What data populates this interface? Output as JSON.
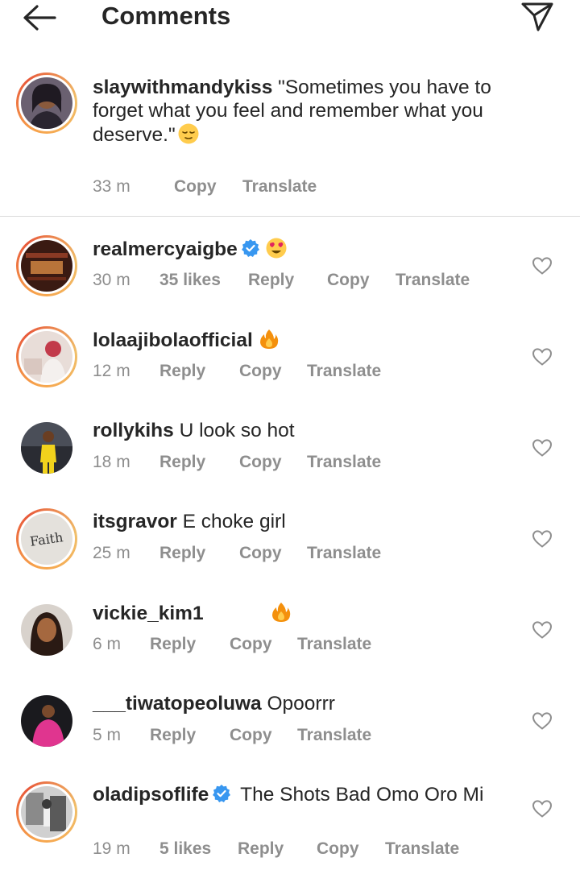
{
  "header": {
    "title": "Comments",
    "back_icon": "arrow-left-icon",
    "send_icon": "paper-plane-icon"
  },
  "caption": {
    "username": "slaywithmandykiss",
    "text": "\"Sometimes you have to forget what you feel and remember what you deserve.\"",
    "emoji": "relieved-face-emoji",
    "time": "33 m",
    "copy_label": "Copy",
    "translate_label": "Translate"
  },
  "comments": [
    {
      "username": "realmercyaigbe",
      "verified": true,
      "text": "",
      "emoji": "heart-eyes-emoji",
      "time": "30 m",
      "likes": "35 likes",
      "reply_label": "Reply",
      "copy_label": "Copy",
      "translate_label": "Translate"
    },
    {
      "username": "lolaajibolaofficial",
      "verified": false,
      "text": "",
      "emoji": "fire-emoji",
      "time": "12 m",
      "reply_label": "Reply",
      "copy_label": "Copy",
      "translate_label": "Translate"
    },
    {
      "username": "rollykihs",
      "verified": false,
      "text": "U look so hot",
      "time": "18 m",
      "reply_label": "Reply",
      "copy_label": "Copy",
      "translate_label": "Translate"
    },
    {
      "username": "itsgravor",
      "verified": false,
      "text": "E choke girl",
      "avatar_text": "Faith",
      "time": "25 m",
      "reply_label": "Reply",
      "copy_label": "Copy",
      "translate_label": "Translate"
    },
    {
      "username": "vickie_kim1",
      "verified": false,
      "text": "",
      "emoji": "fire-emoji",
      "time": "6 m",
      "reply_label": "Reply",
      "copy_label": "Copy",
      "translate_label": "Translate"
    },
    {
      "username": "___tiwatopeoluwa",
      "verified": false,
      "text": "Opoorrr",
      "time": "5 m",
      "reply_label": "Reply",
      "copy_label": "Copy",
      "translate_label": "Translate"
    },
    {
      "username": "oladipsoflife",
      "verified": true,
      "text": "The Shots Bad Omo Oro Mi",
      "time": "19 m",
      "likes": "5 likes",
      "reply_label": "Reply",
      "copy_label": "Copy",
      "translate_label": "Translate"
    }
  ],
  "colors": {
    "text": "#262626",
    "muted": "#8e8e8e",
    "verified": "#3897f0",
    "divider": "#dbdbdb"
  }
}
